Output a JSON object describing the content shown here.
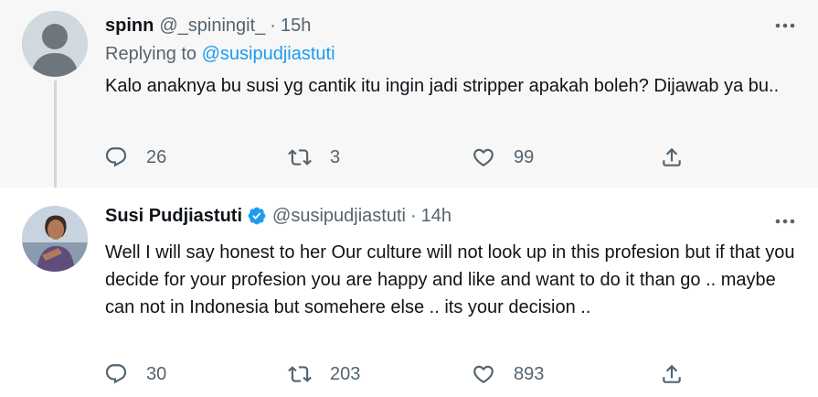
{
  "tweet1": {
    "name": "spinn",
    "handle": "@_spiningit_",
    "separator": "·",
    "time": "15h",
    "replying_prefix": "Replying to",
    "replying_to": "@susipudjiastuti",
    "text": "Kalo anaknya bu susi yg cantik itu ingin jadi stripper apakah boleh? Dijawab ya bu..",
    "replies": "26",
    "retweets": "3",
    "likes": "99",
    "avatar_icon": "default-profile-icon"
  },
  "tweet2": {
    "name": "Susi Pudjiastuti",
    "verified": true,
    "handle": "@susipudjiastuti",
    "separator": "·",
    "time": "14h",
    "text": "Well I will say honest to her Our culture will not look up in this profesion but if that you decide for your profesion you are happy and like and want to do it than go .. maybe can not in Indonesia but somehere else .. its your decision ..",
    "replies": "30",
    "retweets": "203",
    "likes": "893",
    "avatar_icon": "profile-photo"
  },
  "colors": {
    "accent": "#1d9bf0",
    "muted": "#536471",
    "text": "#0f1419",
    "highlight_bg": "#f7f7f7"
  },
  "icons": [
    "reply-icon",
    "retweet-icon",
    "like-icon",
    "share-icon",
    "more-icon",
    "verified-badge-icon"
  ]
}
